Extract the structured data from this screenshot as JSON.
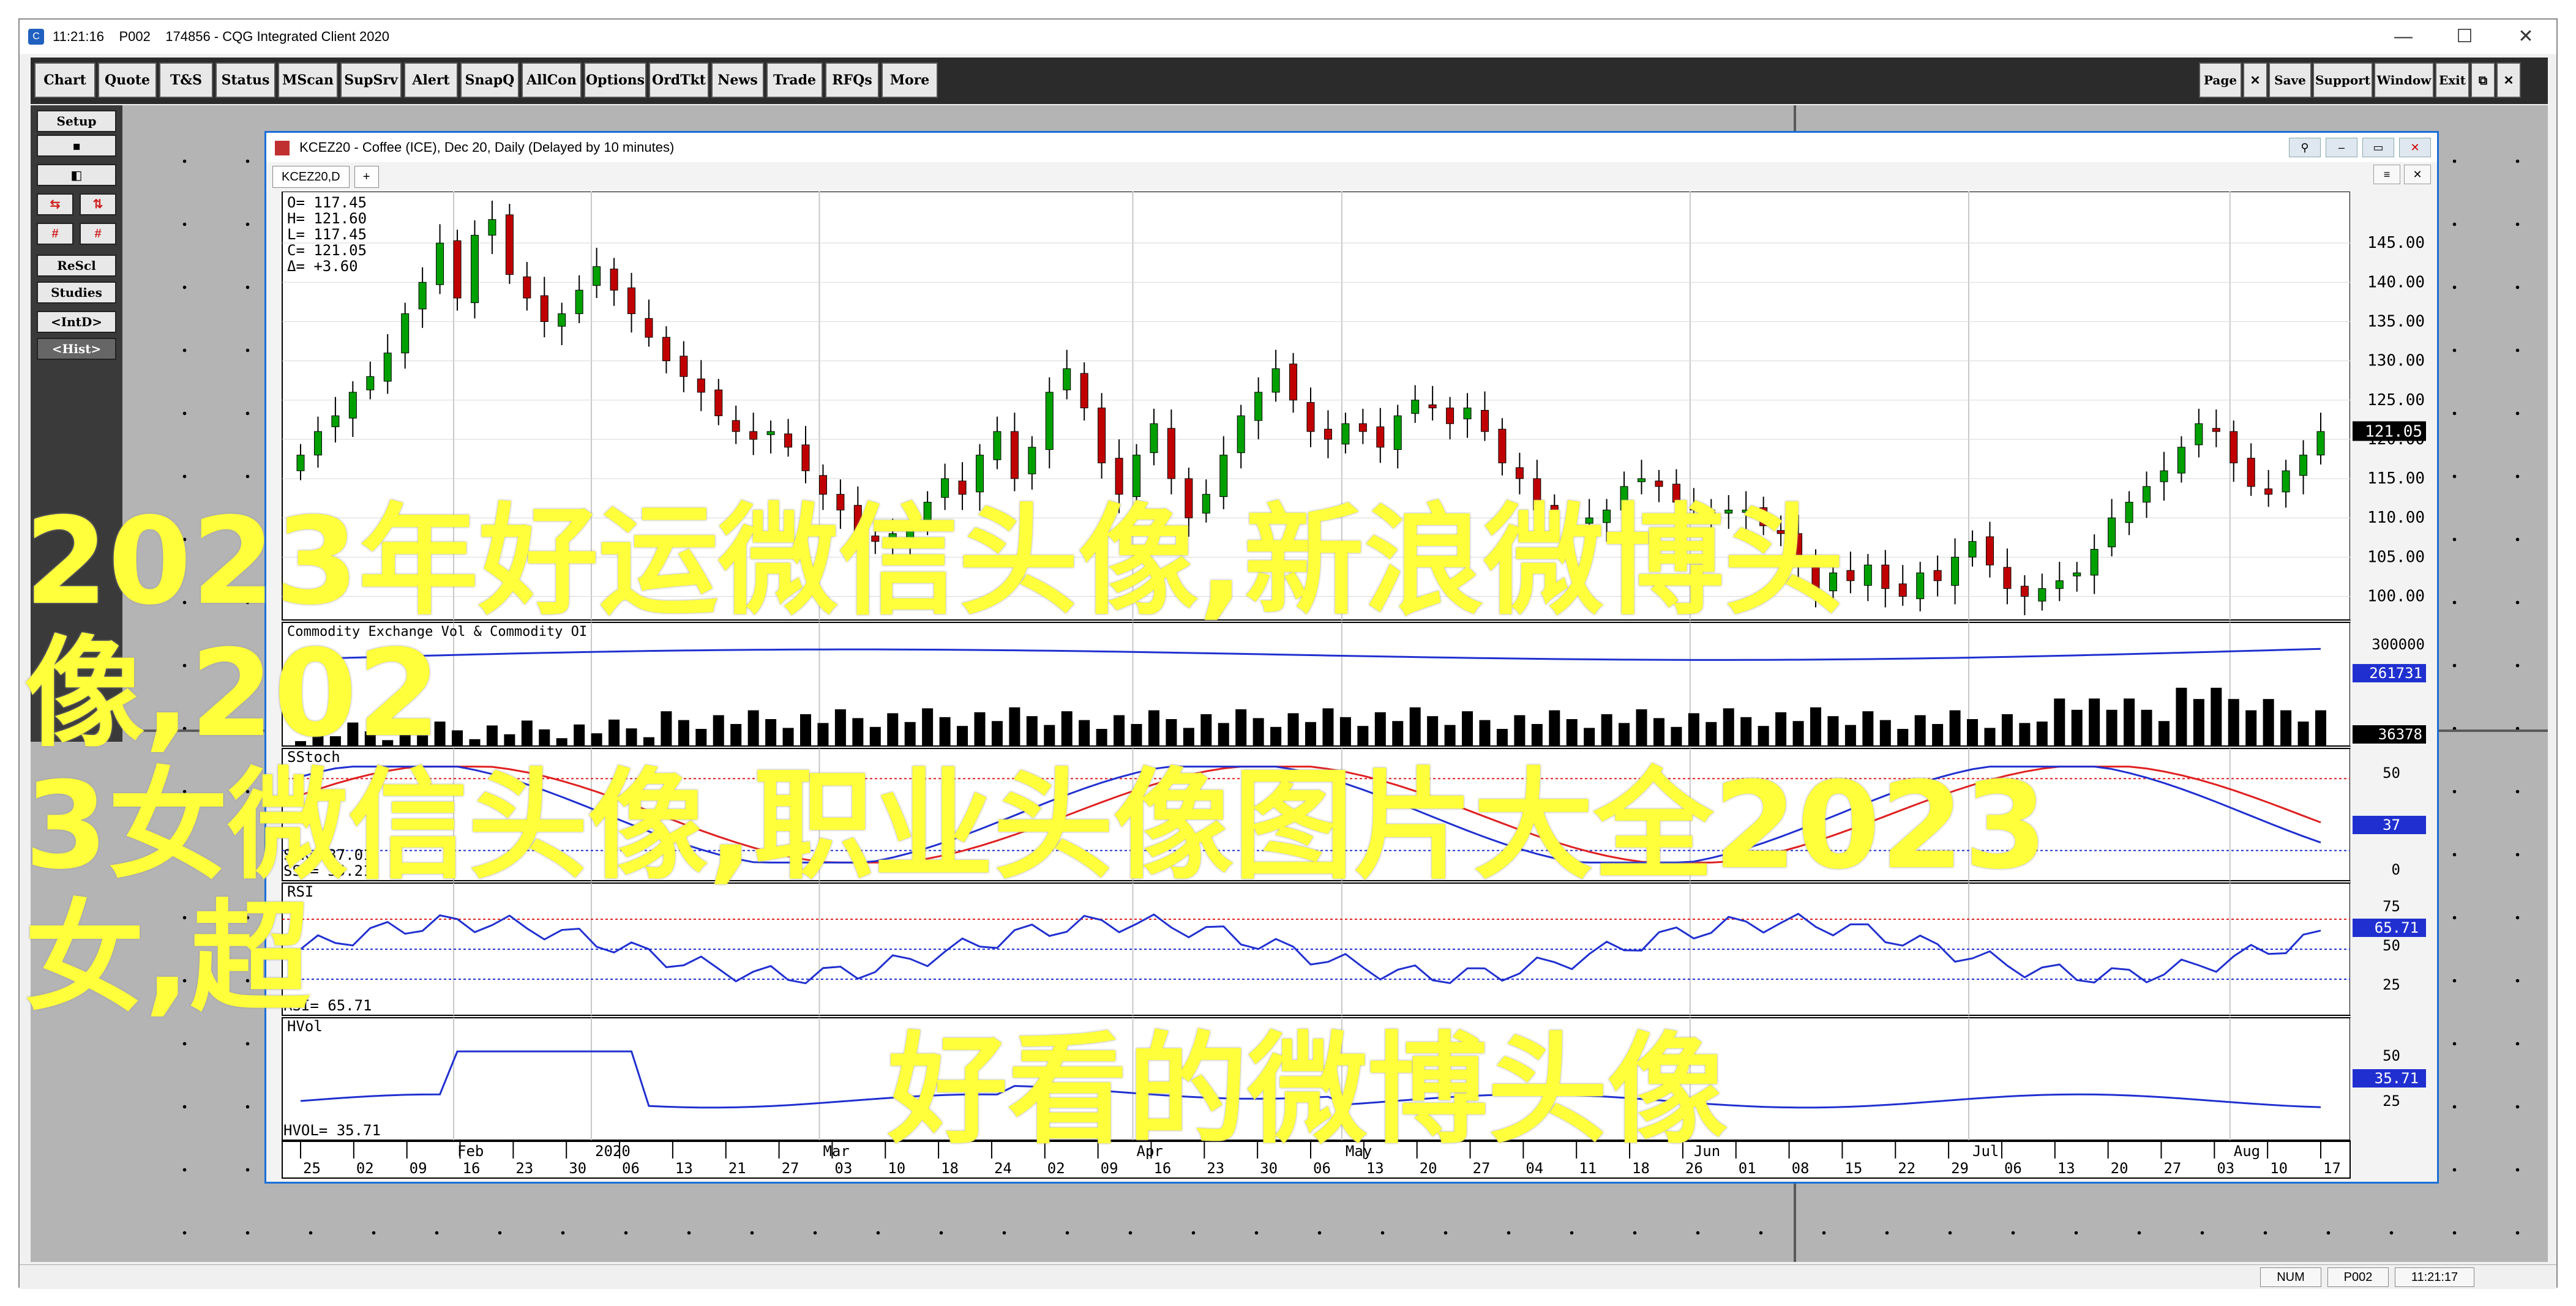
{
  "app": {
    "title": "11:21:16    P002    174856 - CQG Integrated Client 2020",
    "window_controls": [
      "—",
      "☐",
      "✕"
    ]
  },
  "toolbar": {
    "left": [
      "Chart",
      "Quote",
      "T&S",
      "Status",
      "MScan",
      "SupSrv",
      "Alert",
      "SnapQ",
      "AllCon",
      "Options",
      "OrdTkt",
      "News",
      "Trade",
      "RFQs",
      "More"
    ],
    "right": [
      "Page",
      "✕",
      "Save",
      "Support",
      "Window",
      "Exit",
      "⧉",
      "✕"
    ]
  },
  "sidepanel": {
    "setup": "Setup",
    "rescale": "ReScl",
    "studies": "Studies",
    "intd": "<IntD>",
    "hist": "<Hist>"
  },
  "chart_window": {
    "title": "KCEZ20 - Coffee (ICE), Dec 20, Daily (Delayed by 10 minutes)",
    "tab": "KCEZ20,D",
    "tab_plus": "+"
  },
  "chart_data": {
    "type": "candlestick",
    "symbol": "KCEZ20",
    "ohlc_readout": {
      "O": "117.45",
      "H": "121.60",
      "L": "117.45",
      "C": "121.05",
      "Δ": "+3.60"
    },
    "y_ticks": [
      "145.00",
      "140.00",
      "135.00",
      "130.00",
      "125.00",
      "120.00",
      "115.00",
      "110.00",
      "105.00",
      "100.00"
    ],
    "last_price": "121.05",
    "x_month_labels": [
      "2020",
      "Feb",
      "Mar",
      "Apr",
      "May",
      "Jun",
      "Jul",
      "Aug"
    ],
    "x_day_labels": [
      "25",
      "02",
      "09",
      "16",
      "23",
      "30",
      "06",
      "13",
      "21",
      "27",
      "03",
      "10",
      "18",
      "24",
      "02",
      "09",
      "16",
      "23",
      "30",
      "06",
      "13",
      "20",
      "27",
      "04",
      "11",
      "18",
      "26",
      "01",
      "08",
      "15",
      "22",
      "29",
      "06",
      "13",
      "20",
      "27",
      "03",
      "10",
      "17"
    ],
    "closes": [
      118,
      121,
      123,
      126,
      128,
      131,
      136,
      140,
      145,
      138,
      146,
      148,
      141,
      138,
      135,
      136,
      139,
      142,
      139,
      136,
      133,
      130,
      128,
      126,
      123,
      121,
      120,
      121,
      119,
      116,
      113,
      111,
      108,
      107,
      108,
      109,
      112,
      115,
      113,
      118,
      121,
      115,
      119,
      126,
      129,
      124,
      117,
      113,
      118,
      122,
      115,
      110,
      113,
      118,
      123,
      126,
      129,
      125,
      121,
      120,
      122,
      121,
      119,
      123,
      125,
      124,
      122,
      124,
      121,
      117,
      115,
      111,
      110,
      109,
      110,
      111,
      114,
      115,
      114,
      112,
      111,
      110,
      111,
      111,
      109,
      108,
      104,
      101,
      103,
      102,
      104,
      101,
      100,
      103,
      102,
      105,
      107,
      104,
      101,
      100,
      101,
      102,
      103,
      106,
      110,
      112,
      114,
      116,
      119,
      122,
      121,
      117,
      114,
      113,
      116,
      118,
      121
    ],
    "panels": [
      {
        "name": "Commodity Exchange Vol & Commodity OI",
        "ticks": [
          "300000"
        ],
        "labels": {
          "top": "261731",
          "bottom": "36378"
        }
      },
      {
        "name": "SStoch",
        "ticks": [
          "50",
          "0"
        ],
        "readout": {
          "SSK": "37.01",
          "SSD": "35.21"
        },
        "current": "37"
      },
      {
        "name": "RSI",
        "ticks": [
          "75",
          "50",
          "25"
        ],
        "readout": {
          "RSI": "65.71"
        },
        "current": "65.71"
      },
      {
        "name": "HVol",
        "ticks": [
          "50",
          "25"
        ],
        "readout": {
          "HVOL": "35.71"
        },
        "current": "35.71"
      }
    ]
  },
  "statusbar": {
    "num": "NUM",
    "page": "P002",
    "time": "11:21:17"
  },
  "overlay": {
    "line1": "2023年好运微信头像,新浪微博头像,202",
    "line2": "3女微信头像,职业头像图片大全2023女,超",
    "line3": "好看的微博头像"
  },
  "colors": {
    "accent": "#1a6fd8",
    "candle_up": "#00a000",
    "candle_down": "#c00000",
    "indicator_blue": "#2030d0",
    "indicator_red": "#e02020",
    "overlay": "#ffff3c"
  }
}
